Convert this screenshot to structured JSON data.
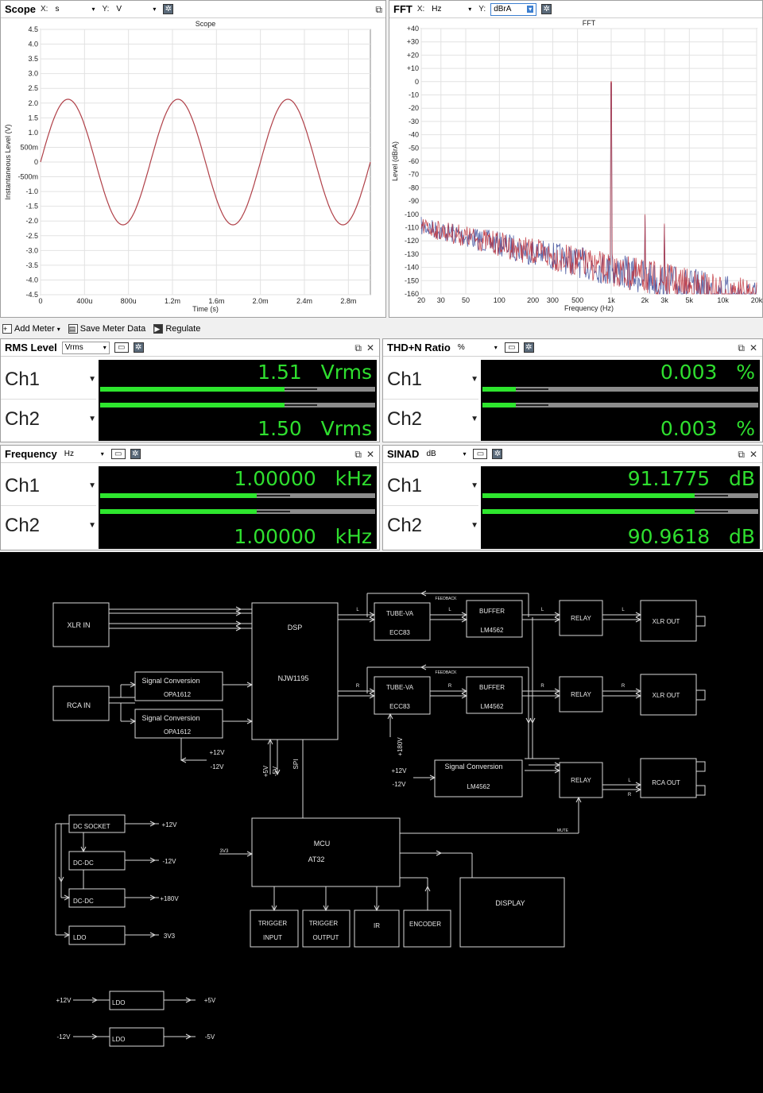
{
  "scope": {
    "title": "Scope",
    "x_label": "X:",
    "x_unit": "s",
    "y_label": "Y:",
    "y_unit": "V",
    "chart_title": "Scope",
    "xlabel": "Time (s)",
    "ylabel": "Instantaneous Level (V)",
    "y_ticks": [
      "4.5",
      "4.0",
      "3.5",
      "3.0",
      "2.5",
      "2.0",
      "1.5",
      "1.0",
      "500m",
      "0",
      "-500m",
      "-1.0",
      "-1.5",
      "-2.0",
      "-2.5",
      "-3.0",
      "-3.5",
      "-4.0",
      "-4.5"
    ],
    "x_ticks": [
      "0",
      "400u",
      "800u",
      "1.2m",
      "1.6m",
      "2.0m",
      "2.4m",
      "2.8m"
    ]
  },
  "fft": {
    "title": "FFT",
    "x_label": "X:",
    "x_unit": "Hz",
    "y_label": "Y:",
    "y_unit": "dBrA",
    "chart_title": "FFT",
    "xlabel": "Frequency (Hz)",
    "ylabel": "Level (dBrA)",
    "y_ticks": [
      "+40",
      "+30",
      "+20",
      "+10",
      "0",
      "-10",
      "-20",
      "-30",
      "-40",
      "-50",
      "-60",
      "-70",
      "-80",
      "-90",
      "-100",
      "-110",
      "-120",
      "-130",
      "-140",
      "-150",
      "-160"
    ],
    "x_ticks": [
      "20",
      "30",
      "50",
      "100",
      "200",
      "300",
      "500",
      "1k",
      "2k",
      "3k",
      "5k",
      "10k",
      "20k"
    ]
  },
  "chart_data": [
    {
      "type": "line",
      "title": "Scope",
      "xlabel": "Time (s)",
      "ylabel": "Instantaneous Level (V)",
      "xlim": [
        0,
        0.003
      ],
      "ylim": [
        -4.5,
        4.5
      ],
      "grid": true,
      "series": [
        {
          "values_desc": "sine",
          "amplitude": 2.13,
          "frequency_hz": 1000,
          "phase_deg": 0
        }
      ]
    },
    {
      "type": "line",
      "title": "FFT",
      "xlabel": "Frequency (Hz)",
      "ylabel": "Level (dBrA)",
      "xscale": "log",
      "xlim": [
        20,
        20000
      ],
      "ylim": [
        -160,
        40
      ],
      "grid": true,
      "peaks": [
        {
          "x": 1000,
          "y": 0
        },
        {
          "x": 2000,
          "y": -100
        },
        {
          "x": 3000,
          "y": -107
        }
      ],
      "noise_floor": {
        "start": -102,
        "end": -150
      },
      "series_colors": [
        "#3a4a9a",
        "#c0303a"
      ]
    }
  ],
  "toolbar": {
    "add_meter": "Add Meter",
    "save_meter_data": "Save Meter Data",
    "regulate": "Regulate"
  },
  "meters": {
    "rms": {
      "title": "RMS Level",
      "unit_select": "Vrms",
      "ch1_label": "Ch1",
      "ch2_label": "Ch2",
      "ch1_value": "1.51",
      "ch2_value": "1.50",
      "unit": "Vrms",
      "ch1_fill": 0.67,
      "ch2_fill": 0.67
    },
    "thdn": {
      "title": "THD+N Ratio",
      "unit_select": "%",
      "ch1_label": "Ch1",
      "ch2_label": "Ch2",
      "ch1_value": "0.003",
      "ch2_value": "0.003",
      "unit": "%",
      "ch1_fill": 0.12,
      "ch2_fill": 0.12
    },
    "freq": {
      "title": "Frequency",
      "unit_select": "Hz",
      "ch1_label": "Ch1",
      "ch2_label": "Ch2",
      "ch1_value": "1.00000",
      "ch2_value": "1.00000",
      "unit": "kHz",
      "ch1_fill": 0.57,
      "ch2_fill": 0.57
    },
    "sinad": {
      "title": "SINAD",
      "unit_select": "dB",
      "ch1_label": "Ch1",
      "ch2_label": "Ch2",
      "ch1_value": "91.1775",
      "ch2_value": "90.9618",
      "unit": "dB",
      "ch1_fill": 0.77,
      "ch2_fill": 0.77
    }
  },
  "diagram": {
    "xlr_in": "XLR  IN",
    "rca_in": "RCA  IN",
    "dsp": "DSP",
    "njw": "NJW1195",
    "sig_conv_1": "Signal  Conversion",
    "sig_conv_1b": "OPA1612",
    "sig_conv_2": "Signal  Conversion",
    "sig_conv_2b": "OPA1612",
    "p12v": "+12V",
    "m12v": "-12V",
    "tube1": "TUBE-VA",
    "tube1b": "ECC83",
    "tube2": "TUBE-VA",
    "tube2b": "ECC83",
    "buf1": "BUFFER",
    "buf1b": "LM4562",
    "buf2": "BUFFER",
    "buf2b": "LM4562",
    "relay1": "RELAY",
    "relay2": "RELAY",
    "relay3": "RELAY",
    "xlr_out1": "XLR  OUT",
    "xlr_out2": "XLR  OUT",
    "rca_out": "RCA  OUT",
    "feedback": "FEEDBACK",
    "l": "L",
    "r": "R",
    "p180v": "+180V",
    "p5v": "+5V",
    "m5v": "-5V",
    "spi": "SPI",
    "sig_conv_3": "Signal  Conversion",
    "sig_conv_3b": "LM4562",
    "mute": "MUTE",
    "dc_socket": "DC  SOCKET",
    "dcdc1": "DC-DC",
    "dcdc2": "DC-DC",
    "ldo": "LDO",
    "p180": "+180V",
    "v3v3": "3V3",
    "mcu": "MCU",
    "at32": "AT32",
    "trigger_in_1": "TRIGGER",
    "trigger_in_2": "INPUT",
    "trigger_out_1": "TRIGGER",
    "trigger_out_2": "OUTPUT",
    "ir": "IR",
    "encoder": "ENCODER",
    "display": "DISPLAY",
    "ldo_p5": "+5V",
    "ldo_m5": "-5V"
  }
}
